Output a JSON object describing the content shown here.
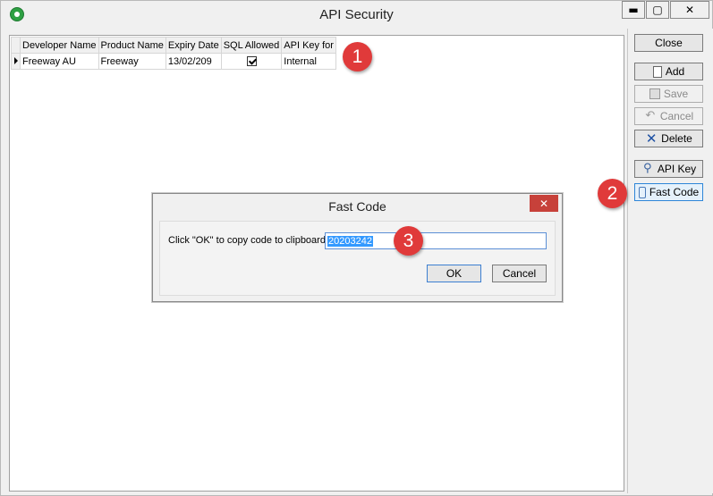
{
  "window": {
    "title": "API Security",
    "minimize_glyph": "▬",
    "maximize_glyph": "▢",
    "close_glyph": "✕"
  },
  "grid": {
    "columns": [
      "Developer Name",
      "Product Name",
      "Expiry Date",
      "SQL Allowed",
      "API Key for"
    ],
    "rows": [
      {
        "developer_name": "Freeway AU",
        "product_name": "Freeway",
        "expiry_date": "13/02/209",
        "sql_allowed": true,
        "api_key_for": "Internal"
      }
    ]
  },
  "toolbar": {
    "close_label": "Close",
    "add_label": "Add",
    "save_label": "Save",
    "cancel_label": "Cancel",
    "delete_label": "Delete",
    "api_key_label": "API Key",
    "fast_code_label": "Fast Code"
  },
  "icons": {
    "add": "document-icon",
    "save": "save-icon",
    "cancel": "undo-icon",
    "delete": "delete-x-icon",
    "api_key": "key-icon",
    "fast_code": "phone-icon"
  },
  "dialog": {
    "title": "Fast Code",
    "close_glyph": "✕",
    "prompt": "Click \"OK\" to copy code to clipboard",
    "code_value": "20203242",
    "ok_label": "OK",
    "cancel_label": "Cancel"
  },
  "callouts": [
    "1",
    "2",
    "3"
  ],
  "colors": {
    "callout": "#e03a3a",
    "selection": "#3399ff",
    "dialog_close": "#c7413a"
  }
}
